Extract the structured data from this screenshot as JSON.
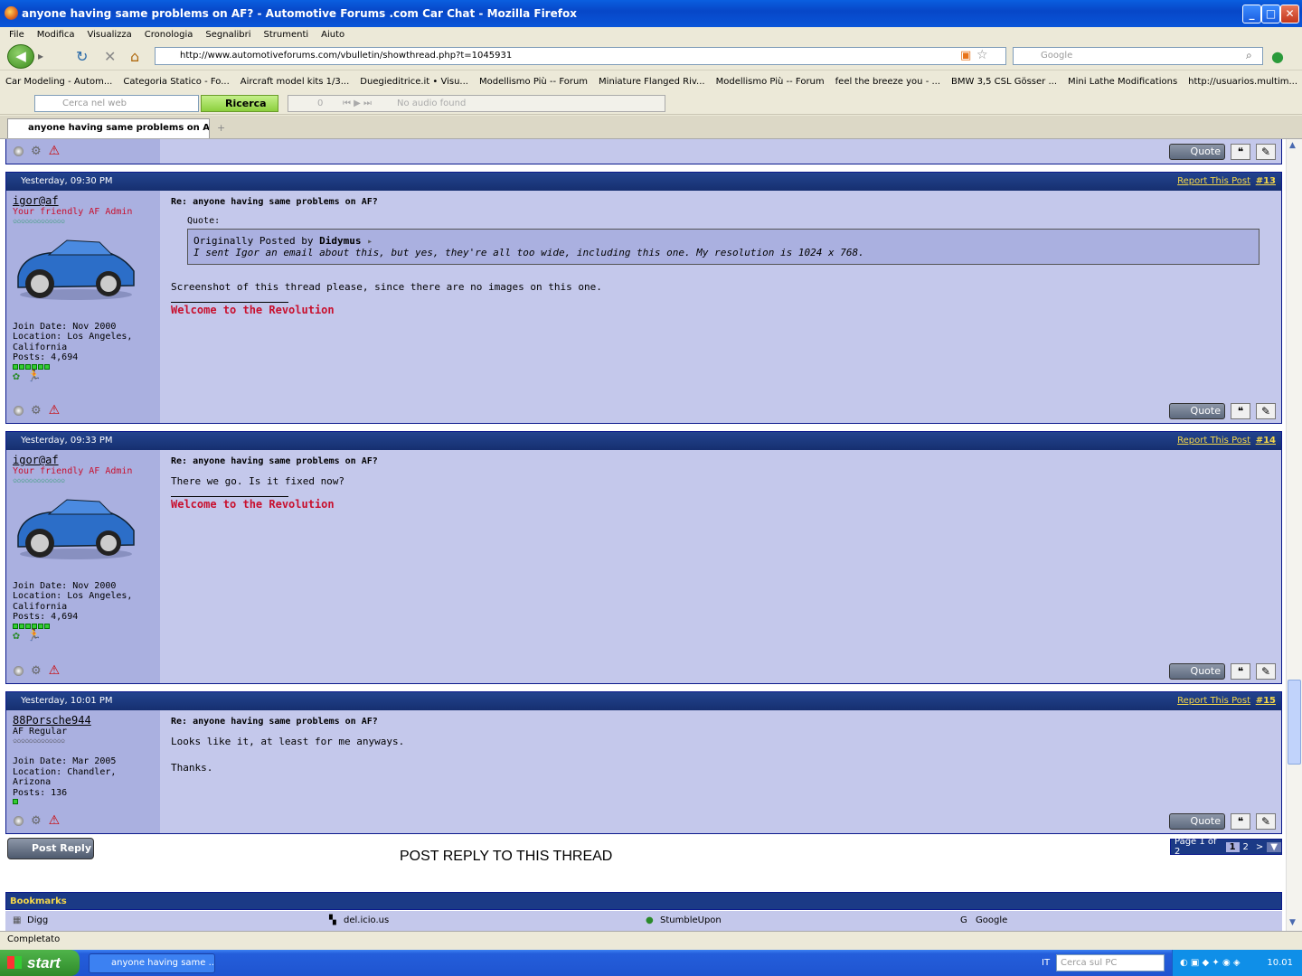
{
  "window": {
    "title": "anyone having same problems on AF? - Automotive Forums .com Car Chat - Mozilla Firefox"
  },
  "menu": [
    "File",
    "Modifica",
    "Visualizza",
    "Cronologia",
    "Segnalibri",
    "Strumenti",
    "Aiuto"
  ],
  "nav": {
    "url": "http://www.automotiveforums.com/vbulletin/showthread.php?t=1045931",
    "search_placeholder": "Google"
  },
  "bookmarks": [
    "Car Modeling - Autom...",
    "Categoria Statico - Fo...",
    "Aircraft model kits 1/3...",
    "Duegieditrice.it • Visu...",
    "Modellismo Più -- Forum",
    "Miniature Flanged Riv...",
    "Modellismo Più -- Forum",
    "feel the breeze you - ...",
    "BMW 3,5 CSL Gösser ...",
    "Mini Lathe Modifications",
    "http://usuarios.multim..."
  ],
  "toolbar2": {
    "search_placeholder": "Cerca nel web",
    "search_btn": "Ricerca",
    "count": "0",
    "audio": "No audio found"
  },
  "tab": {
    "label": "anyone having same problems on AF..."
  },
  "posts": [
    {
      "date": "Yesterday, 09:30 PM",
      "report": "Report This Post",
      "num": "#13",
      "user": "igor@af",
      "utitle": "Your friendly AF Admin",
      "join": "Join Date: Nov 2000",
      "location": "Location: Los Angeles, California",
      "posts": "Posts: 4,694",
      "title": "Re: anyone having same problems on AF?",
      "quote_label": "Quote:",
      "quote_by_prefix": "Originally Posted by ",
      "quote_by": "Didymus",
      "quote_text": "I sent Igor an email about this, but yes, they're all too wide, including this one. My resolution is 1024 x 768.",
      "text": "Screenshot of this thread please, since there are no images on this one.",
      "sig": "Welcome to the Revolution",
      "quote_btn": "Quote"
    },
    {
      "date": "Yesterday, 09:33 PM",
      "report": "Report This Post",
      "num": "#14",
      "user": "igor@af",
      "utitle": "Your friendly AF Admin",
      "join": "Join Date: Nov 2000",
      "location": "Location: Los Angeles, California",
      "posts": "Posts: 4,694",
      "title": "Re: anyone having same problems on AF?",
      "text": "There we go. Is it fixed now?",
      "sig": "Welcome to the Revolution",
      "quote_btn": "Quote"
    },
    {
      "date": "Yesterday, 10:01 PM",
      "report": "Report This Post",
      "num": "#15",
      "user": "88Porsche944",
      "utitle": "AF Regular",
      "join": "Join Date: Mar 2005",
      "location": "Location: Chandler, Arizona",
      "posts": "Posts: 136",
      "title": "Re: anyone having same problems on AF?",
      "text": "Looks like it, at least for me anyways.",
      "text2": "Thanks.",
      "quote_btn": "Quote"
    }
  ],
  "top_quote_btn": "Quote",
  "post_reply": "Post Reply",
  "post_reply_caption": "POST REPLY TO THIS THREAD",
  "pager": {
    "label": "Page 1 of 2",
    "p1": "1",
    "p2": "2",
    "next": ">"
  },
  "bookmarks_section": {
    "title": "Bookmarks",
    "items": [
      "Digg",
      "del.icio.us",
      "StumbleUpon",
      "Google"
    ]
  },
  "status": "Completato",
  "taskbar": {
    "start": "start",
    "task": "anyone having same ...",
    "lang": "IT",
    "pc_search": "Cerca sul PC",
    "time": "10.01"
  }
}
